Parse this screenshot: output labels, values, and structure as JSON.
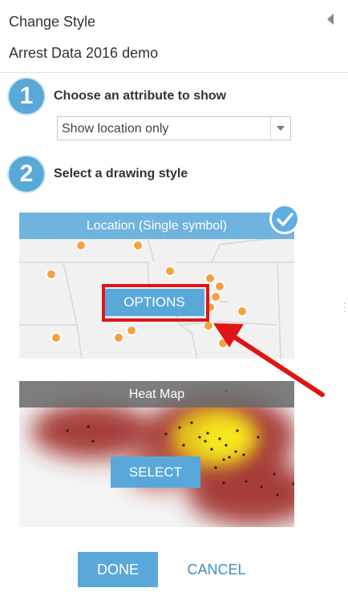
{
  "panel": {
    "title": "Change Style",
    "subtitle": "Arrest Data 2016 demo"
  },
  "steps": [
    {
      "number": "1",
      "text": "Choose an attribute to show"
    },
    {
      "number": "2",
      "text": "Select a drawing style"
    }
  ],
  "attribute_select": {
    "value": "Show location only"
  },
  "styles": {
    "location": {
      "header": "Location (Single symbol)",
      "button": "OPTIONS",
      "selected": true
    },
    "heatmap": {
      "header": "Heat Map",
      "button": "SELECT",
      "selected": false
    }
  },
  "footer": {
    "done": "DONE",
    "cancel": "CANCEL"
  },
  "colors": {
    "accent": "#5aa8d9",
    "point": "#f5a142",
    "highlight": "#e01414"
  }
}
